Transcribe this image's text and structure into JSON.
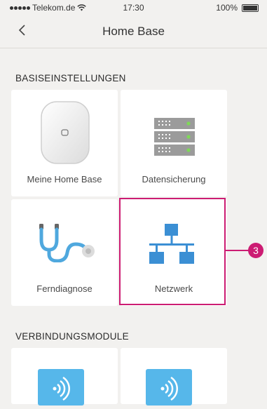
{
  "status_bar": {
    "carrier": "Telekom.de",
    "time": "17:30",
    "battery": "100%"
  },
  "nav": {
    "title": "Home Base",
    "back_icon": "chevron-left-icon"
  },
  "sections": {
    "basic": {
      "header": "BASISEINSTELLUNGEN",
      "tiles": [
        {
          "label": "Meine Home Base",
          "icon": "home-base-device-icon"
        },
        {
          "label": "Datensicherung",
          "icon": "server-rack-icon"
        },
        {
          "label": "Ferndiagnose",
          "icon": "stethoscope-icon"
        },
        {
          "label": "Netzwerk",
          "icon": "network-icon"
        }
      ]
    },
    "modules": {
      "header": "VERBINDUNGSMODULE",
      "tiles": [
        {
          "icon": "wireless-module-icon"
        },
        {
          "icon": "wireless-module-icon"
        }
      ]
    }
  },
  "annotation": {
    "callout_number": "3"
  },
  "colors": {
    "background": "#f2f1ef",
    "tile": "#ffffff",
    "accent_blue": "#3b8fd4",
    "highlight": "#cc1c73",
    "server_green": "#7ed957"
  }
}
